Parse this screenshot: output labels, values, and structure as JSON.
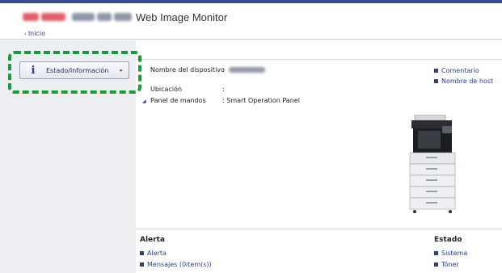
{
  "header": {
    "app_title": "Web Image Monitor"
  },
  "breadcrumb": {
    "home_label": "Inicio"
  },
  "sidebar": {
    "nav_button_label": "Estado/Información"
  },
  "device_info": {
    "rows": [
      {
        "label": "Nombre del dispositivo",
        "value": ":"
      },
      {
        "label": "Ubicación",
        "value": ":"
      },
      {
        "label": "Panel de mandos",
        "value": ": Smart Operation Panel"
      }
    ]
  },
  "right_links": [
    "Comentario",
    "Nombre de host"
  ],
  "alert_section": {
    "title": "Alerta",
    "links": [
      "Alerta",
      "Mensajes (0item(s))"
    ]
  },
  "status_section": {
    "title": "Estado",
    "links": [
      "Sistema",
      "Tóner"
    ]
  },
  "colors": {
    "accent": "#2a3f8f",
    "highlight": "#1f9a3a"
  },
  "icons": [
    "info-icon",
    "chevron-right-icon",
    "chevron-left-icon",
    "printer-image"
  ]
}
